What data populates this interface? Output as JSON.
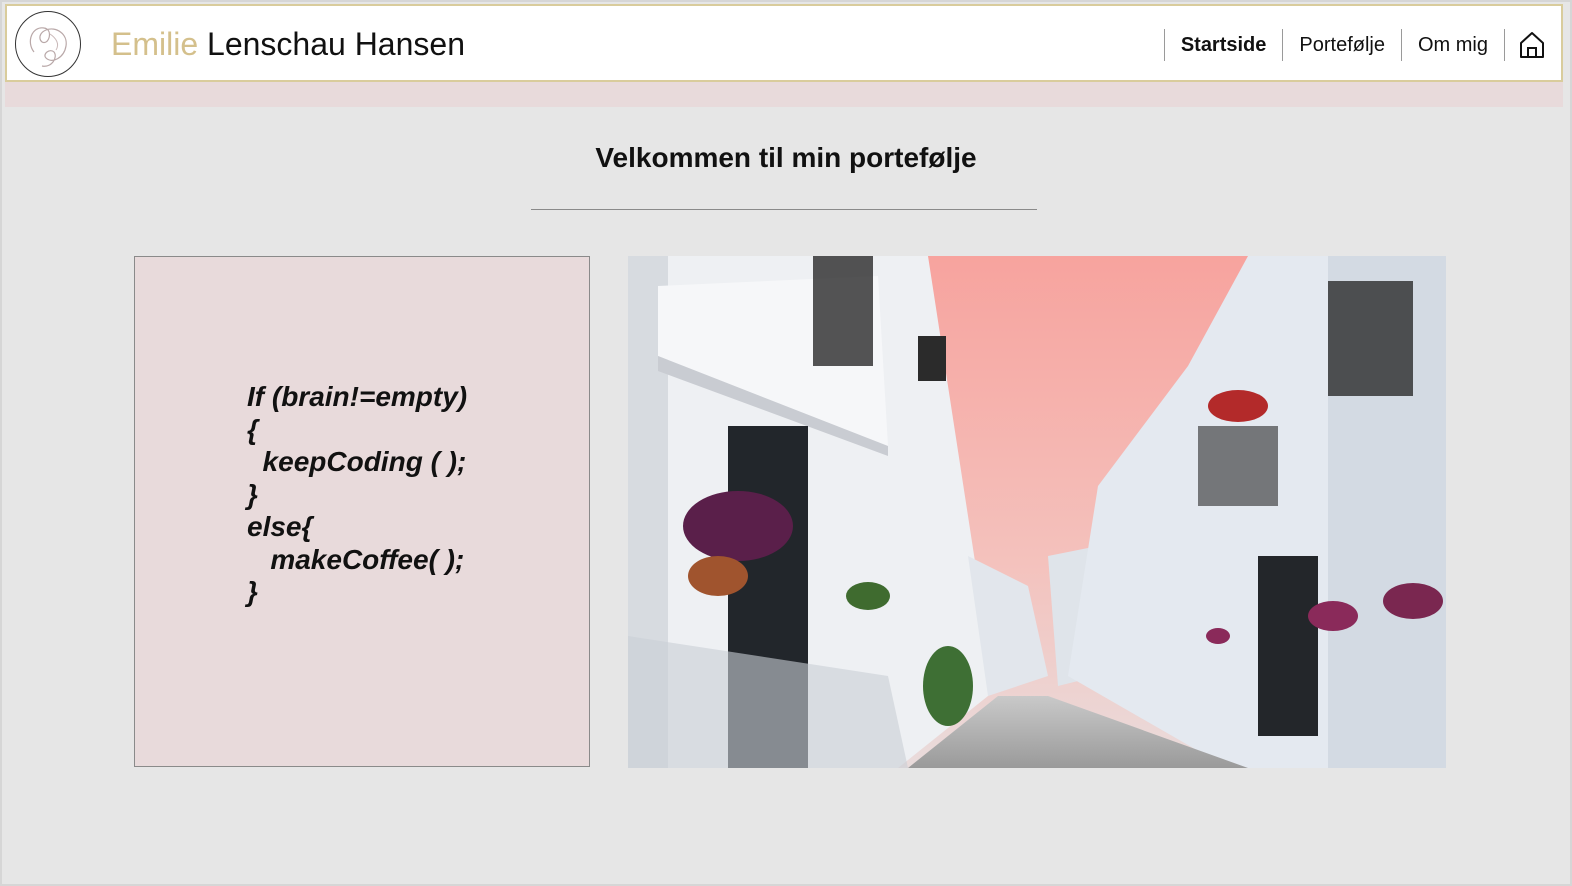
{
  "header": {
    "logo_icon": "monogram-logo-icon",
    "title_first": "Emilie",
    "title_rest": "Lenschau Hansen",
    "accent_color": "#d4c08c",
    "nav": [
      {
        "label": "Startside",
        "active": true
      },
      {
        "label": "Portefølje",
        "active": false
      },
      {
        "label": "Om mig",
        "active": false
      }
    ],
    "home_icon": "home-icon"
  },
  "main": {
    "heading": "Velkommen til min portefølje",
    "code_lines": [
      "If (brain!=empty)",
      "{",
      "  keepCoding ( );",
      "}",
      "else{",
      "   makeCoffee( );",
      "}"
    ],
    "photo_description_icon": "street-photo"
  },
  "colors": {
    "strip": "#e8dadb",
    "header_border": "#d9cc9c",
    "background": "#e6e6e6"
  }
}
